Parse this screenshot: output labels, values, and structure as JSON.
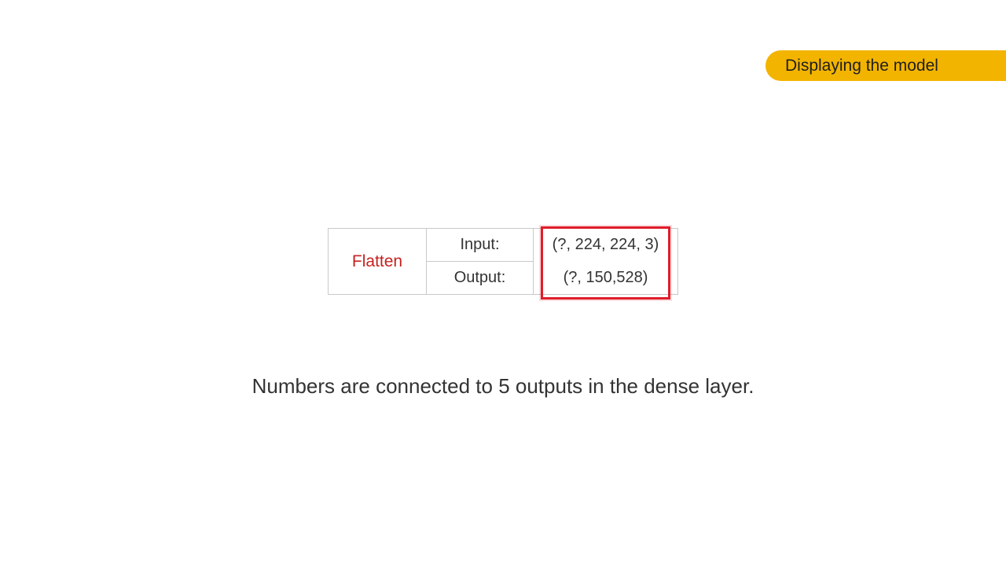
{
  "header": {
    "section_label": "Displaying the model"
  },
  "layer": {
    "name": "Flatten",
    "input_label": "Input:",
    "input_value": "(?, 224, 224, 3)",
    "output_label": "Output:",
    "output_value": "(?, 150,528)"
  },
  "caption": "Numbers are connected to 5 outputs in the dense layer.",
  "colors": {
    "pill_background": "#f3b400",
    "layer_name": "#c5221f",
    "highlight_border": "#e01d2b"
  }
}
